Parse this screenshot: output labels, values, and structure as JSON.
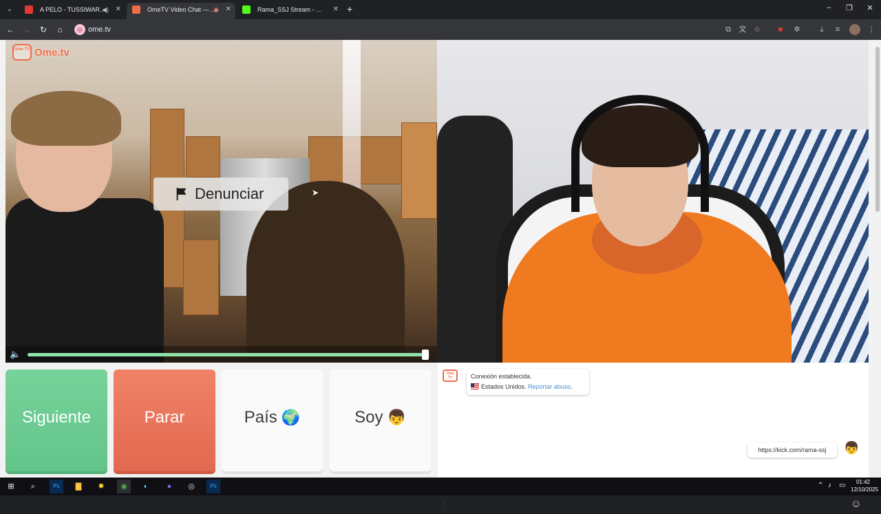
{
  "browser": {
    "tabs": [
      {
        "label": "A PELO - TUSSIWARRIORS",
        "active": false,
        "favicon_color": "#e53935"
      },
      {
        "label": "OmeTV Video Chat — Ome",
        "active": true,
        "favicon_color": "#ef6c4a"
      },
      {
        "label": "Rama_SSJ Stream - Watch Live",
        "active": false,
        "favicon_color": "#53fc18"
      }
    ],
    "new_tab": "+",
    "url": "ome.tv"
  },
  "page": {
    "logo_text": "Ome.tv",
    "logo_tv_text": "Ome TV",
    "report_button": "Denunciar",
    "volume_level": 0.99
  },
  "controls": {
    "next": "Siguiente",
    "stop": "Parar",
    "country": "País",
    "country_emoji": "🌍",
    "gender": "Soy",
    "gender_emoji": "👦"
  },
  "chat": {
    "system_line1": "Conexión establecida.",
    "system_country": "Estados Unidos.",
    "report_link": "Reportar abuso",
    "report_link_suffix": ".",
    "my_message": "https://kick.com/rama-ssj",
    "my_avatar": "👦",
    "input_value": ""
  },
  "taskbar": {
    "time": "01:42",
    "date": "12/10/2025"
  },
  "colors": {
    "next": "#6fcd95",
    "stop": "#ea7358",
    "brand": "#ef6c4a",
    "link": "#4a8fd4"
  }
}
